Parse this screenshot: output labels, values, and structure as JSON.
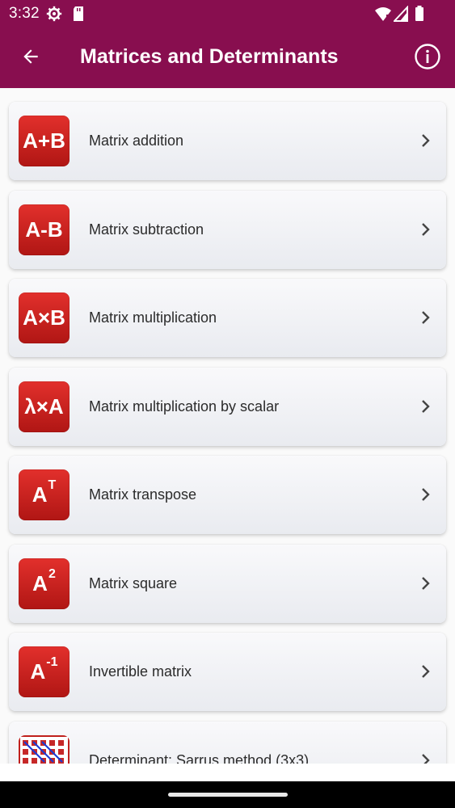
{
  "status_bar": {
    "time": "3:32",
    "icons": [
      "settings-gear-icon",
      "sd-card-icon",
      "wifi-icon",
      "signal-icon",
      "battery-icon"
    ]
  },
  "app_bar": {
    "title": "Matrices and Determinants",
    "back_icon": "arrow-left-icon",
    "info_icon": "info-icon"
  },
  "colors": {
    "primary": "#880e4f",
    "icon_red": "#c62828",
    "card_bg": "#f0f1f5"
  },
  "items": [
    {
      "icon_text": "A+B",
      "icon_sup": "",
      "label": "Matrix addition"
    },
    {
      "icon_text": "A-B",
      "icon_sup": "",
      "label": "Matrix subtraction"
    },
    {
      "icon_text": "A×B",
      "icon_sup": "",
      "label": "Matrix multiplication"
    },
    {
      "icon_text": "λ×A",
      "icon_sup": "",
      "label": "Matrix multiplication by scalar"
    },
    {
      "icon_text": "A",
      "icon_sup": "T",
      "label": "Matrix transpose"
    },
    {
      "icon_text": "A",
      "icon_sup": "2",
      "label": "Matrix square"
    },
    {
      "icon_text": "A",
      "icon_sup": "-1",
      "label": "Invertible matrix"
    },
    {
      "icon_text": "",
      "icon_sup": "",
      "label": "Determinant: Sarrus method (3x3)"
    }
  ]
}
